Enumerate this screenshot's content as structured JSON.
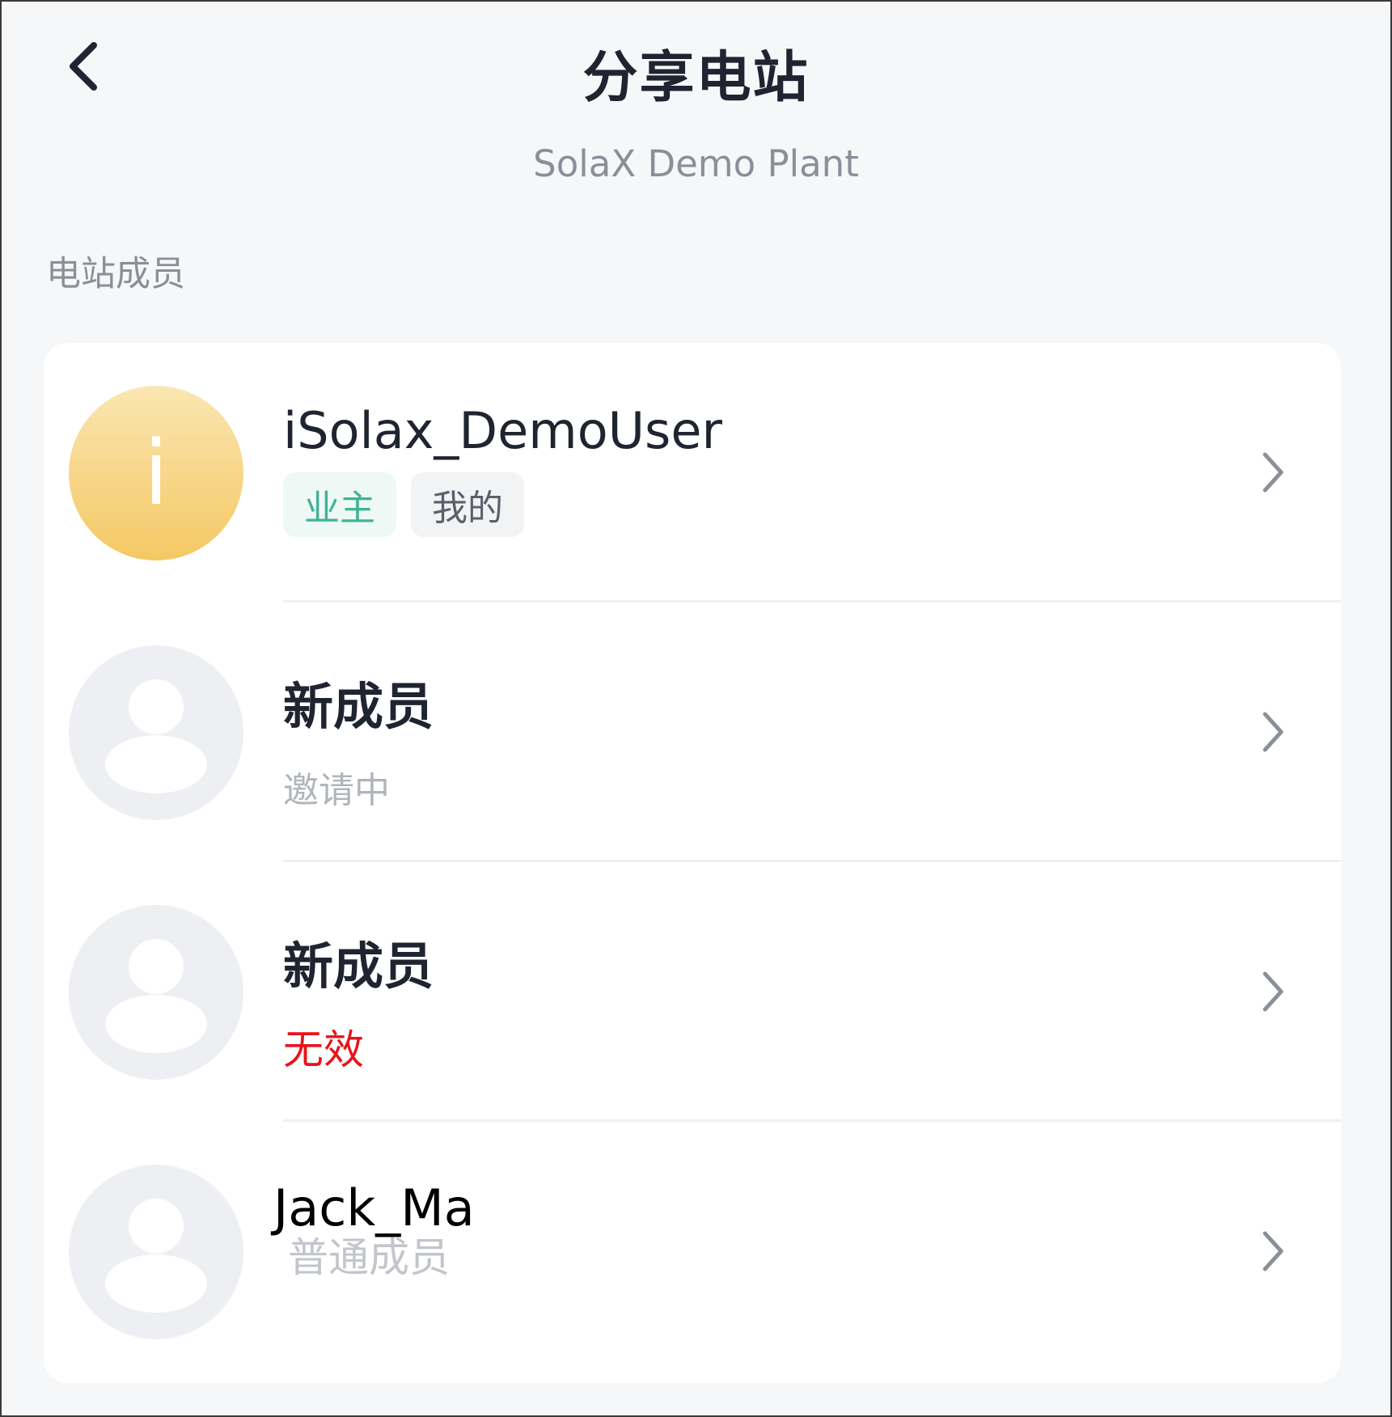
{
  "header": {
    "title": "分享电站",
    "subtitle": "SolaX Demo Plant",
    "back_icon": "chevron-left-icon"
  },
  "section": {
    "label": "电站成员"
  },
  "members": [
    {
      "name": "iSolax_DemoUser",
      "avatar_initial": "i",
      "tags": [
        "业主",
        "我的"
      ]
    },
    {
      "name": "新成员",
      "status": "邀请中"
    },
    {
      "name": "新成员",
      "status": "无效"
    },
    {
      "name": "Jack_Ma",
      "status": "普通成员"
    }
  ],
  "colors": {
    "background": "#f6f7f9",
    "card": "#ffffff",
    "owner_tag_text": "#3fb394",
    "invalid_text": "#e8141a",
    "avatar_gradient_top": "#fae6b1",
    "avatar_gradient_bottom": "#f5c864"
  }
}
